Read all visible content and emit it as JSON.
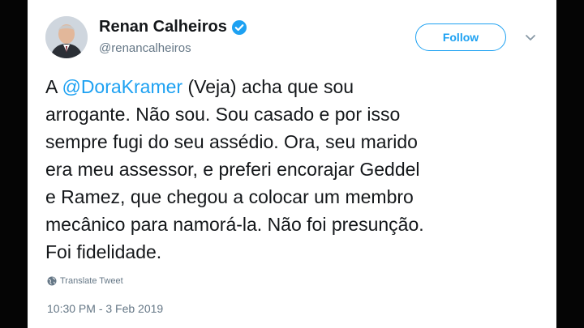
{
  "tweet": {
    "author_name": "Renan Calheiros",
    "author_handle": "@renancalheiros",
    "verified": true,
    "follow_label": "Follow",
    "text_lines": [
      {
        "pre": "A ",
        "mention": "@DoraKramer",
        "post": " (Veja) acha que sou"
      },
      {
        "pre": "arrogante. Não sou. Sou casado e por isso"
      },
      {
        "pre": "sempre fugi do seu assédio. Ora, seu marido"
      },
      {
        "pre": "era meu assessor, e preferi encorajar Geddel"
      },
      {
        "pre": "e Ramez, que chegou a colocar um membro"
      },
      {
        "pre": "mecânico para namorá-la. Não foi presunção."
      },
      {
        "pre": "Foi fidelidade."
      }
    ],
    "translate_label": "Translate Tweet",
    "timestamp": "10:30 PM - 3 Feb 2019"
  },
  "icons": {
    "verified": "verified-badge-icon",
    "caret": "chevron-down-icon",
    "translate": "globe-icon"
  },
  "colors": {
    "accent": "#1da1f2",
    "text": "#14171a",
    "muted": "#657786",
    "letterbox": "#050505"
  }
}
